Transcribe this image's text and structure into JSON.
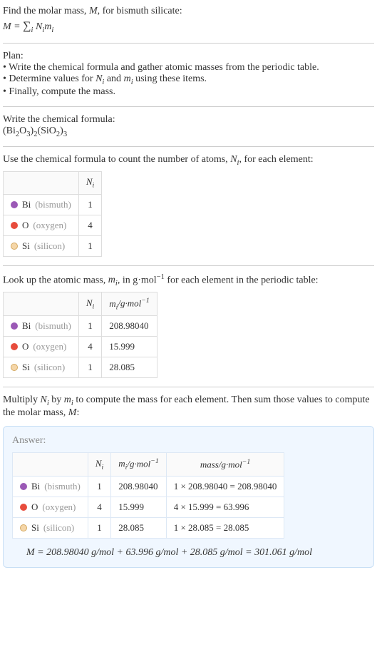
{
  "intro": {
    "line1_a": "Find the molar mass, ",
    "line1_b": ", for bismuth silicate:",
    "formula_lhs": "M",
    "formula_eq": " = ",
    "formula_sub": "i",
    "formula_rhs_a": " N",
    "formula_rhs_b": "m"
  },
  "plan": {
    "title": "Plan:",
    "item1": "• Write the chemical formula and gather atomic masses from the periodic table.",
    "item2_a": "• Determine values for ",
    "item2_b": " and ",
    "item2_c": " using these items.",
    "item3": "• Finally, compute the mass."
  },
  "chemformula": {
    "title": "Write the chemical formula:",
    "part1": "(Bi",
    "s1": "2",
    "part2": "O",
    "s2": "3",
    "part3": ")",
    "s3": "2",
    "part4": "(SiO",
    "s4": "2",
    "part5": ")",
    "s5": "3"
  },
  "count": {
    "intro_a": "Use the chemical formula to count the number of atoms, ",
    "intro_b": ", for each element:"
  },
  "lookup": {
    "intro_a": "Look up the atomic mass, ",
    "intro_b": ", in g·mol",
    "intro_c": " for each element in the periodic table:"
  },
  "multiply": {
    "intro_a": "Multiply ",
    "intro_b": " by ",
    "intro_c": " to compute the mass for each element. Then sum those values to compute the molar mass, ",
    "intro_d": ":"
  },
  "labels": {
    "N": "N",
    "Ni": "i",
    "m": "m",
    "mi": "i",
    "M": "M",
    "gmol": "/g·mol",
    "neg1": "−1",
    "mass": "mass/g·mol"
  },
  "elements": {
    "bi": {
      "sym": "Bi",
      "name": "(bismuth)"
    },
    "o": {
      "sym": "O",
      "name": "(oxygen)"
    },
    "si": {
      "sym": "Si",
      "name": "(silicon)"
    }
  },
  "chart_data": {
    "type": "table",
    "columns": [
      "element",
      "N_i",
      "m_i_g_per_mol",
      "mass_expr"
    ],
    "rows": [
      {
        "element": "Bi (bismuth)",
        "N_i": 1,
        "m_i": "208.98040",
        "mass": "1 × 208.98040 = 208.98040"
      },
      {
        "element": "O (oxygen)",
        "N_i": 4,
        "m_i": "15.999",
        "mass": "4 × 15.999 = 63.996"
      },
      {
        "element": "Si (silicon)",
        "N_i": 1,
        "m_i": "28.085",
        "mass": "1 × 28.085 = 28.085"
      }
    ],
    "final": "M = 208.98040 g/mol + 63.996 g/mol + 28.085 g/mol = 301.061 g/mol"
  },
  "answer": {
    "label": "Answer:"
  }
}
